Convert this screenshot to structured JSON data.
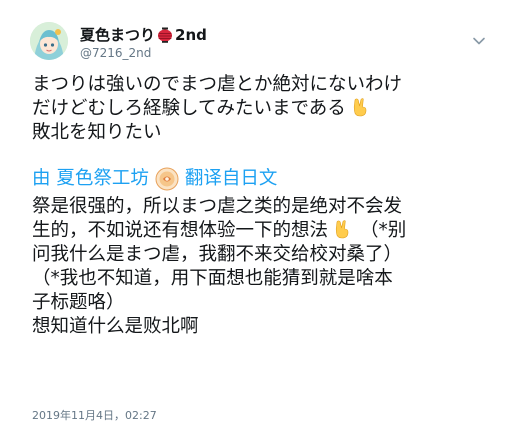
{
  "user": {
    "display_name": "夏色まつり",
    "display_name_suffix": "2nd",
    "handle": "@7216_2nd"
  },
  "tweet": {
    "lines": [
      "まつりは強いのでまつ虐とか絶対にないわけ",
      "だけどむしろ経験してみたいまである",
      "敗北を知りたい"
    ]
  },
  "translation": {
    "label_prefix": "由 夏色祭工坊",
    "label_suffix": "翻译自日文",
    "lines": [
      "祭是很强的，所以まつ虐之类的是绝对不会发",
      "生的，不如说还有想体验一下的想法",
      "问我什么是まつ虐，我翻不来交给校对桑了）",
      "（*我也不知道，用下面想也能猜到就是啥本",
      "子标题咯）",
      "想知道什么是败北啊"
    ],
    "line2_note": "（*别"
  },
  "timestamp": "2019年11月4日，02:27",
  "icons": [
    "avatar",
    "lantern-icon",
    "chevron-down-icon",
    "victory-hand-icon",
    "translate-logo-icon"
  ],
  "colors": {
    "link": "#1da1f2",
    "muted": "#657786",
    "text": "#14171a"
  }
}
